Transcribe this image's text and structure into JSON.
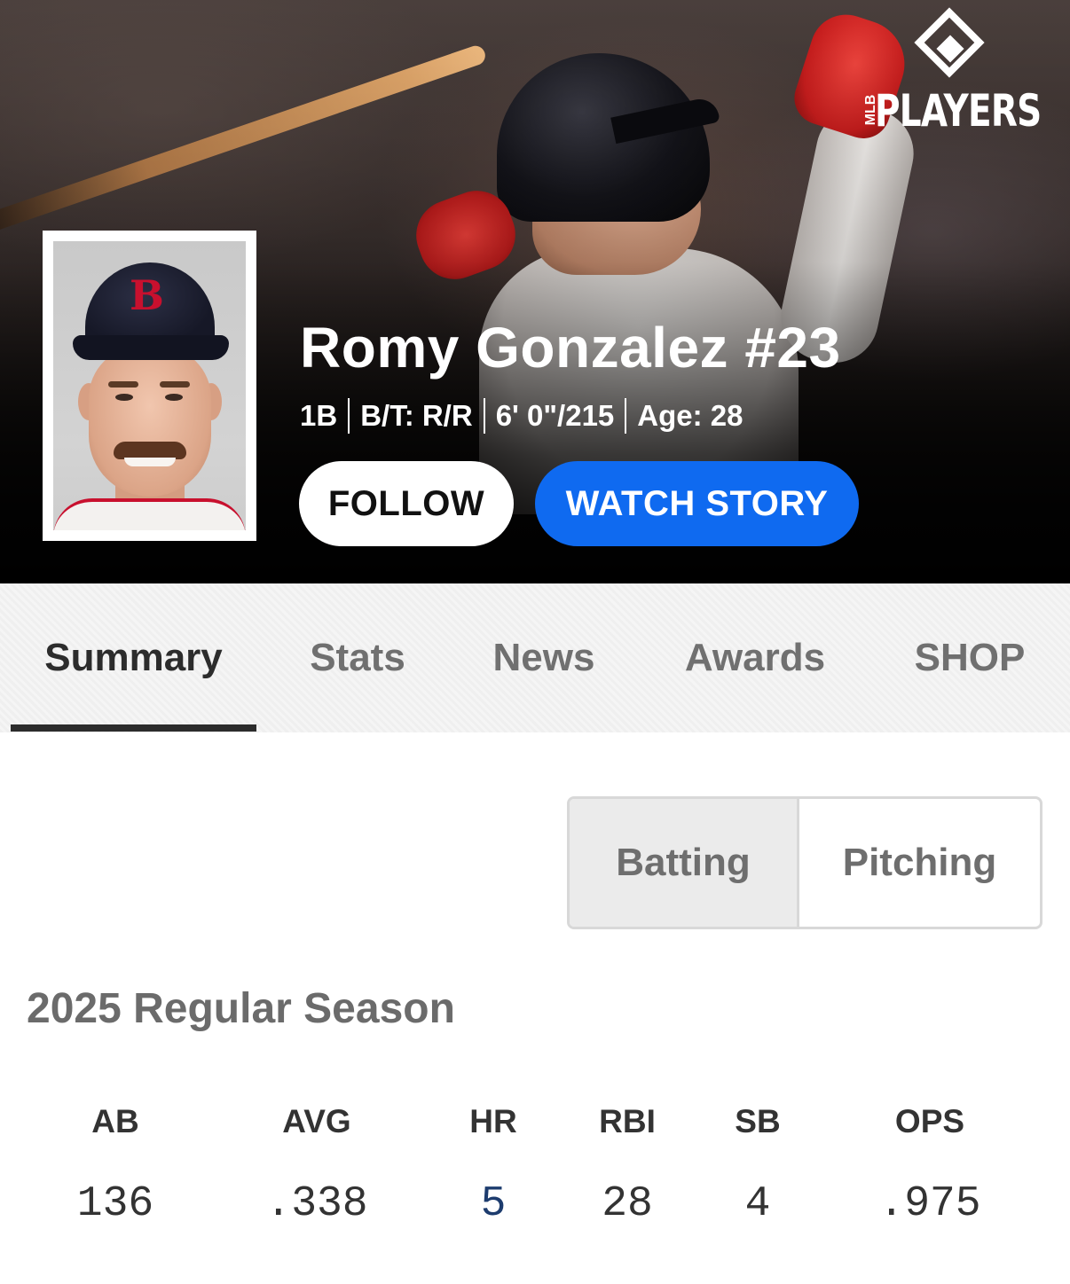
{
  "brand": {
    "logo_text": "PLAYERS",
    "logo_sub": "MLB"
  },
  "player": {
    "name": "Romy Gonzalez #23",
    "position": "1B",
    "bats_throws": "B/T: R/R",
    "height_weight": "6' 0\"/215",
    "age": "Age: 28"
  },
  "actions": {
    "follow_label": "FOLLOW",
    "watch_label": "WATCH STORY"
  },
  "tabs": [
    {
      "label": "Summary",
      "active": true
    },
    {
      "label": "Stats",
      "active": false
    },
    {
      "label": "News",
      "active": false
    },
    {
      "label": "Awards",
      "active": false
    },
    {
      "label": "SHOP",
      "active": false
    }
  ],
  "stat_toggle": {
    "batting": "Batting",
    "pitching": "Pitching",
    "selected": "Batting"
  },
  "season": {
    "title": "2025 Regular Season",
    "headers": [
      "AB",
      "AVG",
      "HR",
      "RBI",
      "SB",
      "OPS"
    ],
    "values": [
      "136",
      ".338",
      "5",
      "28",
      "4",
      ".975"
    ]
  },
  "colors": {
    "accent_blue": "#0f6af0",
    "link_navy": "#1d3c6e",
    "red_sox_red": "#c8102e"
  },
  "icons": [
    "mlb-players-logo-icon"
  ]
}
